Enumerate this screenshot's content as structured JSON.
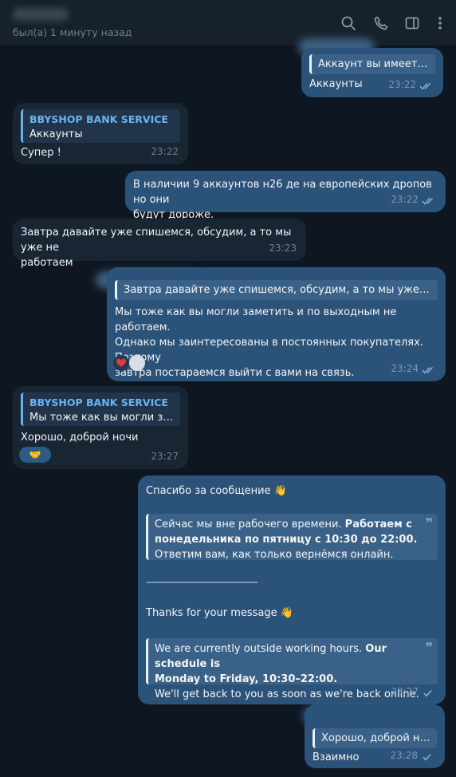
{
  "header": {
    "status": "был(а) 1 минуту назад"
  },
  "messages": {
    "m1": {
      "quote": "Аккаунт вы имеете вв...",
      "text": "Аккаунты",
      "time": "23:22"
    },
    "m2": {
      "quote_title": "BBYSHOP BANK SERVICE",
      "quote": "Аккаунты",
      "text": "Супер !",
      "time": "23:22"
    },
    "m3": {
      "line1": "В наличии 9 аккаунтов н26 де на европейских дропов но они",
      "line2": "будут дороже.",
      "time": "23:22"
    },
    "m4": {
      "line1": "Завтра давайте уже спишемся, обсудим, а то мы уже не",
      "line2": "работаем",
      "time": "23:23"
    },
    "m5": {
      "quote": "Завтра давайте уже спишемся, обсудим, а то мы уже не рабо...",
      "line1": "Мы тоже как вы могли заметить и по выходным не работаем.",
      "line2": "Однако мы заинтересованы в постоянных покупателях. Поэтому",
      "line3": "завтра постараемся выйти с вами на связь.",
      "time": "23:24"
    },
    "m6": {
      "quote_title": "BBYSHOP BANK SERVICE",
      "quote": "Мы тоже как вы могли зам...",
      "text": "Хорошо, доброй ночи",
      "time": "23:27"
    },
    "m7": {
      "greeting": "Спасибо за сообщение 👋",
      "ru_line1a": "Сейчас мы вне рабочего времени. ",
      "ru_line1b": "Работаем с",
      "ru_line2": "понедельника по пятницу с 10:30 до 22:00.",
      "ru_line3": "Ответим вам, как только вернёмся онлайн.",
      "divider": "——————————————",
      "en_greeting": "Thanks for your message 👋",
      "en_line1a": "We are currently outside working hours. ",
      "en_line1b": "Our schedule is",
      "en_line2": "Monday to Friday, 10:30–22:00.",
      "en_line3": "We'll get back to you as soon as we're back online.",
      "time": "23:27"
    },
    "m8": {
      "quote": "Хорошо, доброй ночи",
      "text": "Взаимно",
      "time": "23:28"
    }
  },
  "icons": [
    "search-icon",
    "phone-icon",
    "sidebar-icon",
    "more-icon",
    "double-check-icon",
    "heart-reaction",
    "handshake-reaction"
  ],
  "colors": {
    "bg": "#0e1621",
    "header": "#17212b",
    "outgoing": "#2b5278",
    "incoming": "#182533",
    "accent": "#6ab3f3"
  }
}
